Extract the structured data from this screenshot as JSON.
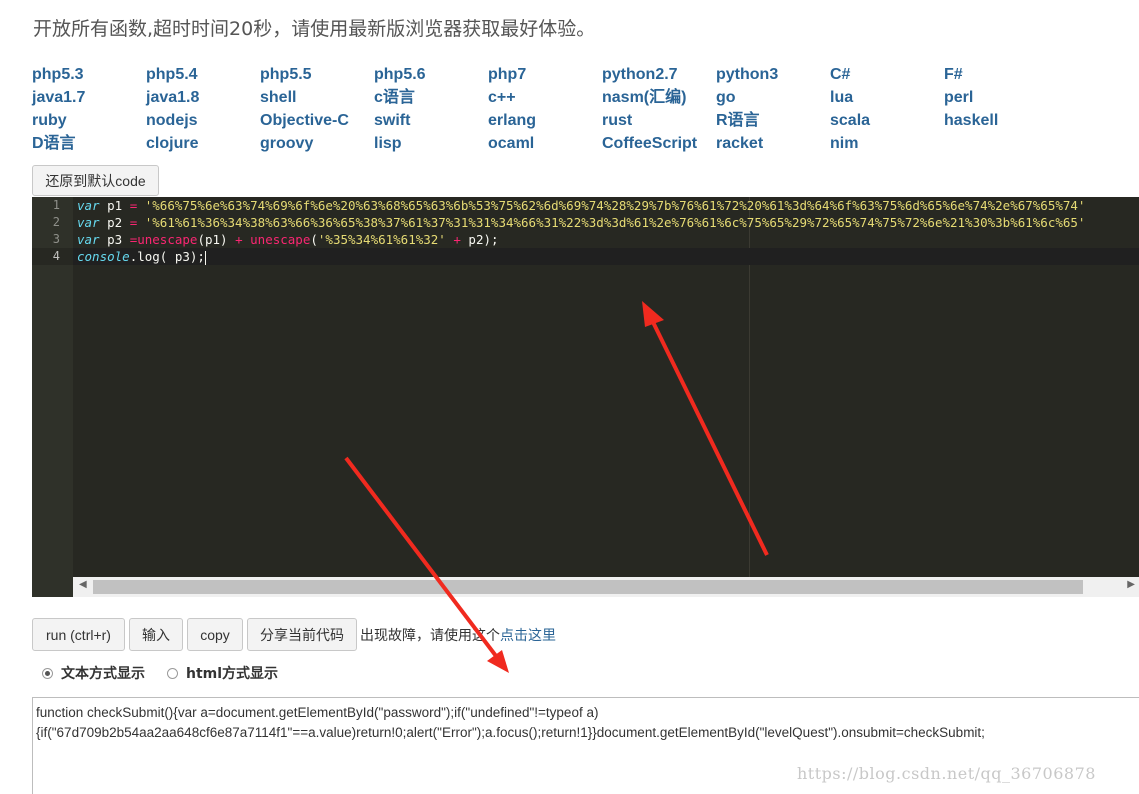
{
  "notice": "开放所有函数,超时时间20秒，请使用最新版浏览器获取最好体验。",
  "languages": [
    [
      "php5.3",
      "php5.4",
      "php5.5",
      "php5.6",
      "php7",
      "python2.7",
      "python3",
      "C#",
      "F#"
    ],
    [
      "java1.7",
      "java1.8",
      "shell",
      "c语言",
      "c++",
      "nasm(汇编)",
      "go",
      "lua",
      "perl"
    ],
    [
      "ruby",
      "nodejs",
      "Objective-C",
      "swift",
      "erlang",
      "rust",
      "R语言",
      "scala",
      "haskell"
    ],
    [
      "D语言",
      "clojure",
      "groovy",
      "lisp",
      "ocaml",
      "CoffeeScript",
      "racket",
      "nim"
    ]
  ],
  "reset_button": "还原到默认code",
  "editor": {
    "line_numbers": [
      "1",
      "2",
      "3",
      "4"
    ],
    "lines": [
      {
        "kw": "var",
        "name": " p1 ",
        "op": "=",
        "rest": " ",
        "str": "'%66%75%6e%63%74%69%6f%6e%20%63%68%65%63%6b%53%75%62%6d%69%74%28%29%7b%76%61%72%20%61%3d%64%6f%63%75%6d%65%6e%74%2e%67%65%74'",
        "tail": ""
      },
      {
        "kw": "var",
        "name": " p2 ",
        "op": "=",
        "rest": " ",
        "str": "'%61%61%36%34%38%63%66%36%65%38%37%61%37%31%31%34%66%31%22%3d%3d%61%2e%76%61%6c%75%65%29%72%65%74%75%72%6e%21%30%3b%61%6c%65'",
        "tail": ""
      }
    ],
    "line3": {
      "kw": "var",
      "a": " p3 ",
      "eq": "=",
      "f1": "unescape",
      "b": "(p1) ",
      "plus1": "+",
      "c": " ",
      "f2": "unescape",
      "d": "(",
      "s": "'%35%34%61%61%32'",
      "e": " ",
      "plus2": "+",
      "f": " p2);"
    },
    "line4": {
      "obj": "console",
      "a": ".log( p3);"
    }
  },
  "buttons": {
    "run": "run (ctrl+r)",
    "input": "输入",
    "copy": "copy",
    "share": "分享当前代码"
  },
  "fault_text": "出现故障，请使用这个",
  "fault_link": "点击这里",
  "radio": {
    "text_mode": "文本方式显示",
    "html_mode": "html方式显示"
  },
  "output": "function checkSubmit(){var a=document.getElementById(\"password\");if(\"undefined\"!=typeof a){if(\"67d709b2b54aa2aa648cf6e87a7114f1\"==a.value)return!0;alert(\"Error\");a.focus();return!1}}document.getElementById(\"levelQuest\").onsubmit=checkSubmit;",
  "watermark": "https://blog.csdn.net/qq_36706878",
  "colors": {
    "link": "#2a6496",
    "editor_bg": "#272822",
    "arrow": "#f02a1f"
  }
}
